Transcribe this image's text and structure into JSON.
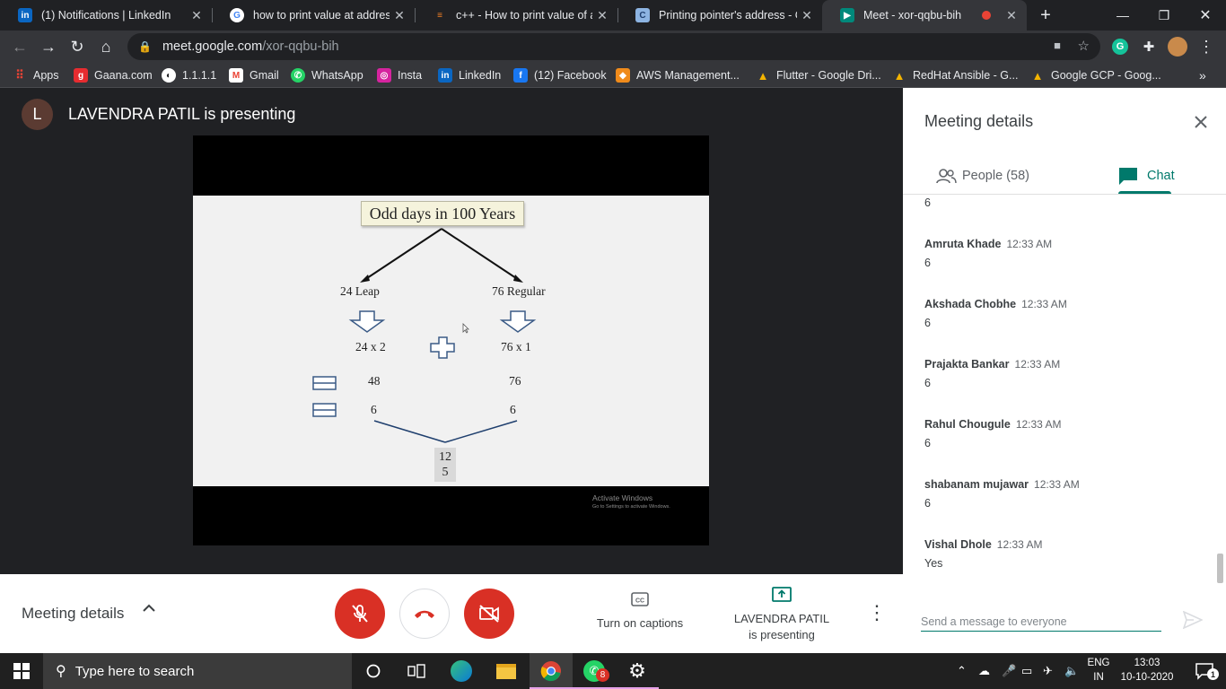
{
  "browser": {
    "tabs": [
      {
        "title": "(1) Notifications | LinkedIn",
        "icon": "linkedin-icon",
        "active": false
      },
      {
        "title": "how to print value at address i",
        "icon": "google-icon",
        "active": false
      },
      {
        "title": "c++ - How to print value of a",
        "icon": "stackoverflow-icon",
        "active": false
      },
      {
        "title": "Printing pointer's address - C+",
        "icon": "cplusplus-icon",
        "active": false
      },
      {
        "title": "Meet - xor-qqbu-bih",
        "icon": "meet-icon",
        "active": true
      }
    ],
    "url_host": "meet.google.com",
    "url_path": "/xor-qqbu-bih",
    "bookmarks": [
      "Apps",
      "Gaana.com",
      "1.1.1.1",
      "Gmail",
      "WhatsApp",
      "Insta",
      "LinkedIn",
      "(12) Facebook",
      "AWS Management...",
      "Flutter - Google Dri...",
      "RedHat Ansible - G...",
      "Google GCP - Goog..."
    ]
  },
  "stage": {
    "presenter_initial": "L",
    "presenter_title": "LAVENDRA PATIL is presenting",
    "slide": {
      "title": "Odd days in 100 Years",
      "leap_label": "24 Leap",
      "regular_label": "76 Regular",
      "leap_expr": "24 x 2",
      "regular_expr": "76 x 1",
      "leap_product": "48",
      "regular_product": "76",
      "leap_odd": "6",
      "regular_odd": "6",
      "result_line1": "12",
      "result_line2": "5"
    },
    "watermark_title": "Activate Windows",
    "watermark_sub": "Go to Settings to activate Windows."
  },
  "panel": {
    "title": "Meeting details",
    "people_tab": "People (58)",
    "chat_tab": "Chat",
    "partial_message": "6",
    "messages": [
      {
        "sender": "Amruta Khade",
        "time": "12:33 AM",
        "text": "6"
      },
      {
        "sender": "Akshada Chobhe",
        "time": "12:33 AM",
        "text": "6"
      },
      {
        "sender": "Prajakta Bankar",
        "time": "12:33 AM",
        "text": "6"
      },
      {
        "sender": "Rahul Chougule",
        "time": "12:33 AM",
        "text": "6"
      },
      {
        "sender": "shabanam mujawar",
        "time": "12:33 AM",
        "text": "6"
      },
      {
        "sender": "Vishal Dhole",
        "time": "12:33 AM",
        "text": "Yes"
      }
    ],
    "composer_placeholder": "Send a message to everyone"
  },
  "bottombar": {
    "meeting_details": "Meeting details",
    "captions_label": "Turn on captions",
    "presenting_line1": "LAVENDRA PATIL",
    "presenting_line2": "is presenting"
  },
  "taskbar": {
    "search_placeholder": "Type here to search",
    "whatsapp_badge": "8",
    "lang_line1": "ENG",
    "lang_line2": "IN",
    "time": "13:03",
    "date": "10-10-2020",
    "notification_count": "1"
  },
  "colors": {
    "meet_teal": "#00796b",
    "control_red": "#d93025",
    "chrome_dark": "#202124",
    "toolbar_gray": "#35363a"
  }
}
